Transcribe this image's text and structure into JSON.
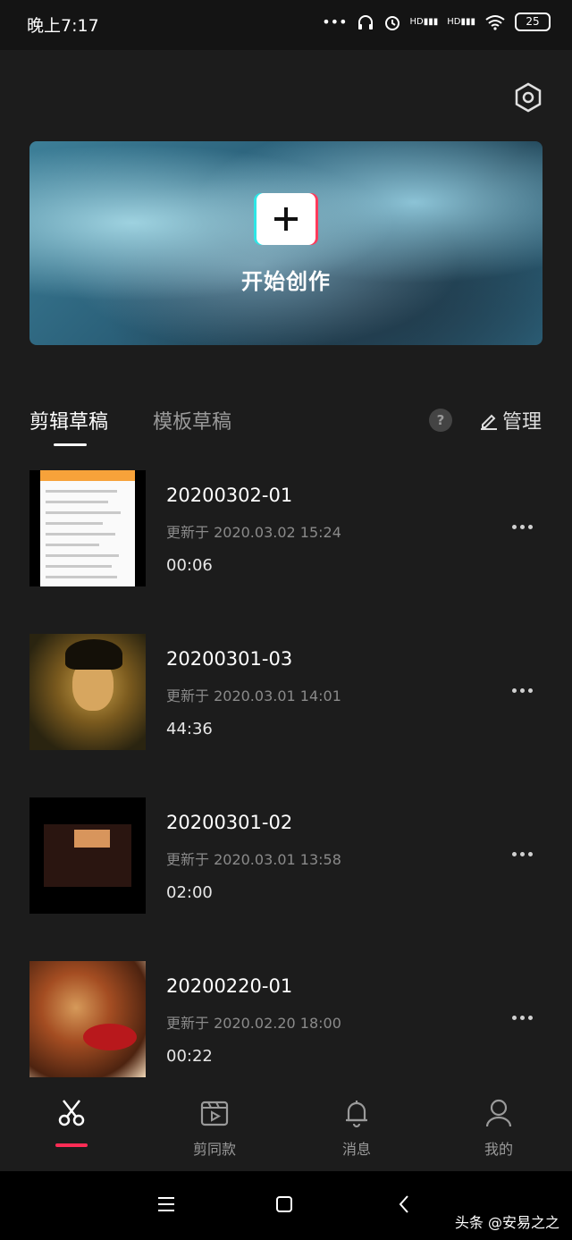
{
  "status_bar": {
    "time": "晚上7:17",
    "battery": "25",
    "signal_label_1": "HD",
    "signal_label_2": "HD"
  },
  "hero": {
    "title": "开始创作"
  },
  "tabs": [
    {
      "label": "剪辑草稿",
      "active": true
    },
    {
      "label": "模板草稿",
      "active": false
    }
  ],
  "help_symbol": "?",
  "manage_label": "管理",
  "drafts": [
    {
      "title": "20200302-01",
      "updated": "更新于 2020.03.02 15:24",
      "duration": "00:06"
    },
    {
      "title": "20200301-03",
      "updated": "更新于 2020.03.01 14:01",
      "duration": "44:36"
    },
    {
      "title": "20200301-02",
      "updated": "更新于 2020.03.01 13:58",
      "duration": "02:00"
    },
    {
      "title": "20200220-01",
      "updated": "更新于 2020.02.20 18:00",
      "duration": "00:22"
    }
  ],
  "bottom_nav": [
    {
      "label": "",
      "icon": "scissors-icon",
      "active": true
    },
    {
      "label": "剪同款",
      "icon": "clapper-icon",
      "active": false
    },
    {
      "label": "消息",
      "icon": "bell-icon",
      "active": false
    },
    {
      "label": "我的",
      "icon": "user-icon",
      "active": false
    }
  ],
  "watermark": "头条 @安易之之",
  "colors": {
    "accent": "#fe2c55",
    "background": "#1c1c1c"
  }
}
